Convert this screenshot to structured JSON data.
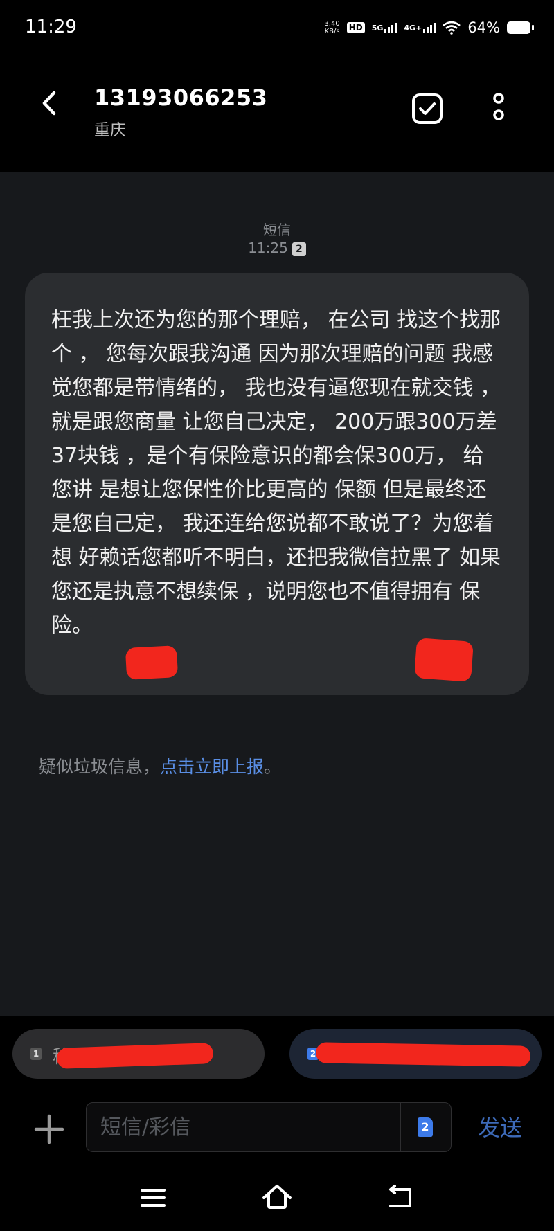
{
  "status_bar": {
    "time": "11:29",
    "net_speed_value": "3.40",
    "net_speed_unit": "KB/s",
    "hd_label": "HD",
    "sim1_network": "5G",
    "sim2_network": "4G+",
    "battery": "64%"
  },
  "header": {
    "title": "13193066253",
    "subtitle": "重庆"
  },
  "conversation": {
    "channel_label": "短信",
    "timestamp": "11:25",
    "sim_badge": "2",
    "message_text": "枉我上次还为您的那个理赔， 在公司 找这个找那个 ， 您每次跟我沟通 因为那次理赔的问题 我感觉您都是带情绪的， 我也没有逼您现在就交钱 ， 就是跟您商量 让您自己决定， 200万跟300万差37块钱 ，是个有保险意识的都会保300万， 给您讲 是想让您保性价比更高的 保额 但是最终还是您自己定， 我还连给您说都不敢说了？为您着想 好赖话您都听不明白，还把我微信拉黑了 如果您还是执意不想续保      ，说明您也不值得拥有      保险。",
    "spam_notice": "疑似垃圾信息，",
    "spam_link": "点击立即上报",
    "spam_end": "。"
  },
  "sim_selector": {
    "sim1_number": "1",
    "sim1_label": "移动",
    "sim2_number": "2"
  },
  "compose": {
    "placeholder": "短信/彩信",
    "sim_icon_label": "2",
    "send_label": "发送"
  },
  "colors": {
    "background": "#000000",
    "conversation_bg": "#17191c",
    "bubble_bg": "#2b2d30",
    "link": "#5a8fe6",
    "accent": "#3d7bea",
    "redaction": "#f2261d"
  }
}
